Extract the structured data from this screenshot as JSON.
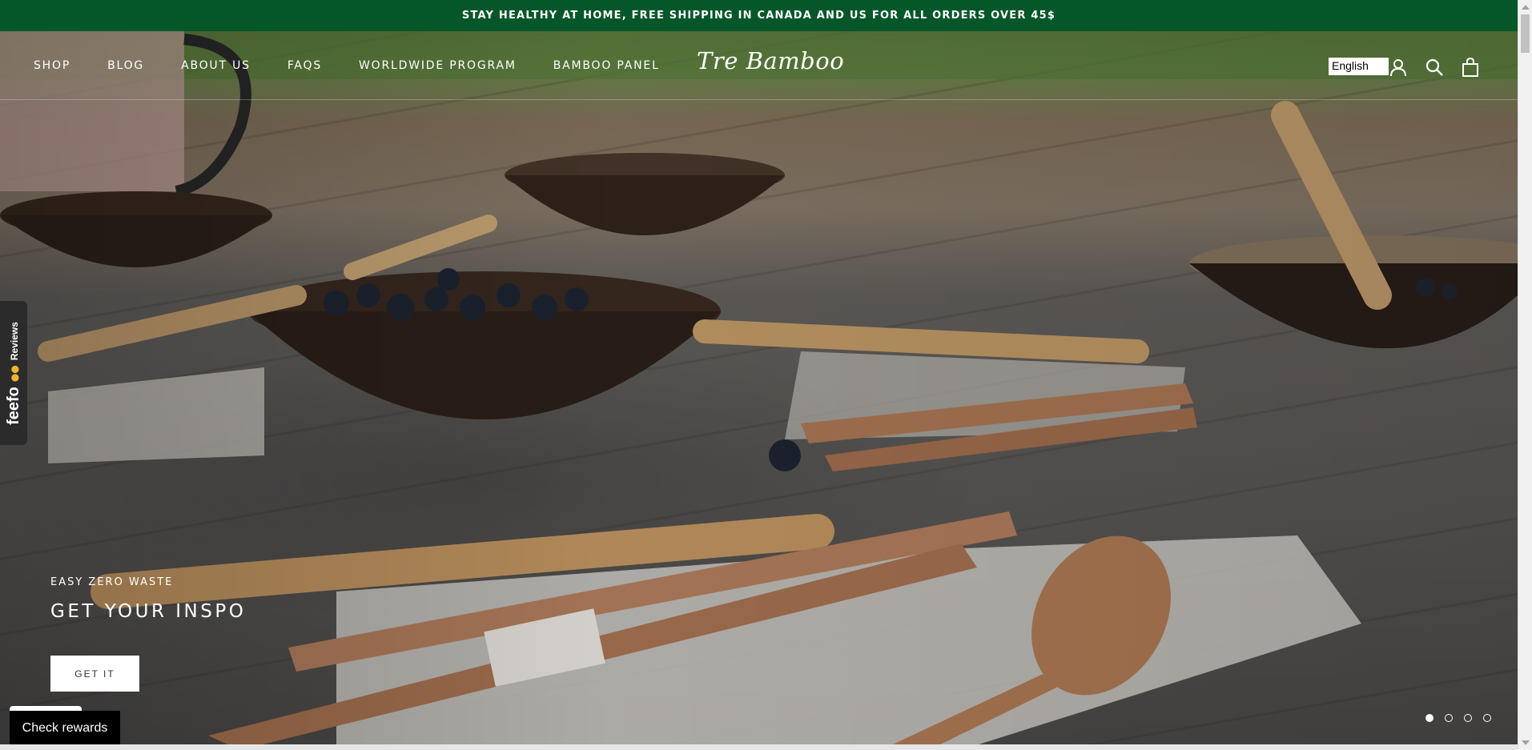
{
  "announcement": "STAY HEALTHY AT HOME, FREE SHIPPING IN CANADA AND US FOR ALL ORDERS OVER 45$",
  "nav": {
    "items": [
      "SHOP",
      "BLOG",
      "ABOUT US",
      "FAQS",
      "WORLDWIDE PROGRAM",
      "BAMBOO PANEL"
    ]
  },
  "logo": "Tre Bamboo",
  "header": {
    "language": "English",
    "icons": [
      "account-icon",
      "search-icon",
      "cart-icon"
    ]
  },
  "feefo": {
    "logo": "feefo",
    "label": "Reviews"
  },
  "hero": {
    "kicker": "EASY ZERO WASTE",
    "headline": "GET YOUR INSPO",
    "cta": "GET IT",
    "slides": 4,
    "active_slide": 1
  },
  "rewards": "Check rewards",
  "colors": {
    "announcement_bg": "#05572a",
    "text_light": "#ffffff"
  }
}
